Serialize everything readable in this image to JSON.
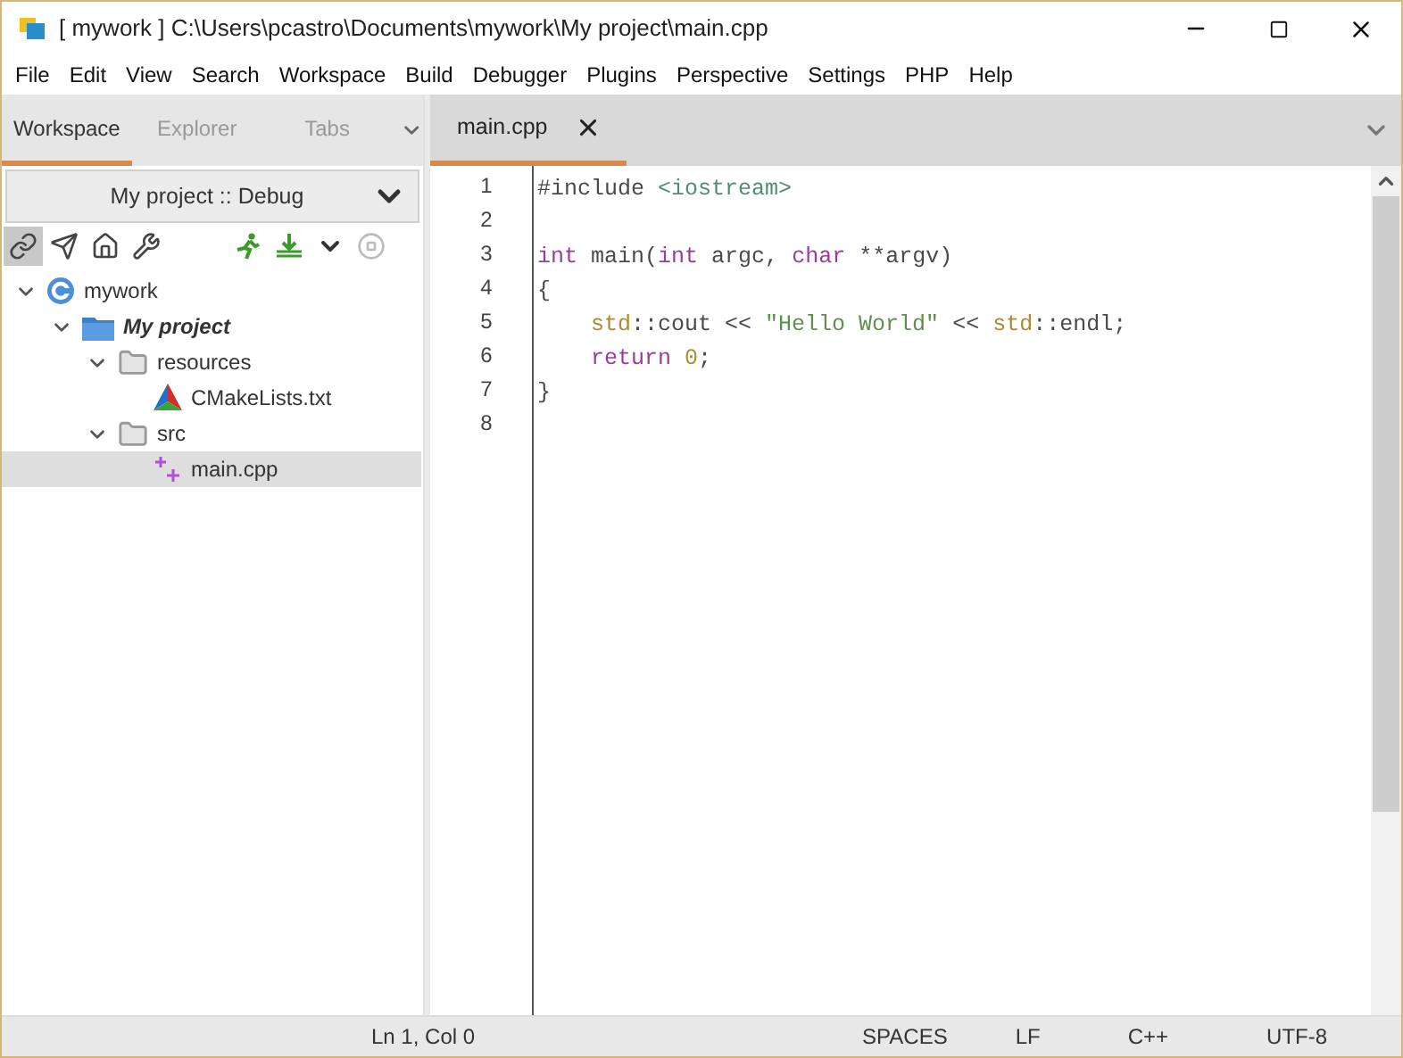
{
  "window": {
    "title": "[ mywork ] C:\\Users\\pcastro\\Documents\\mywork\\My project\\main.cpp"
  },
  "menu": [
    "File",
    "Edit",
    "View",
    "Search",
    "Workspace",
    "Build",
    "Debugger",
    "Plugins",
    "Perspective",
    "Settings",
    "PHP",
    "Help"
  ],
  "side_tabs": [
    {
      "label": "Workspace",
      "selected": true
    },
    {
      "label": "Explorer",
      "selected": false
    },
    {
      "label": "Tabs",
      "selected": false
    }
  ],
  "configuration": {
    "value": "My project :: Debug"
  },
  "toolbar": [
    {
      "kind": "link",
      "selected": true
    },
    {
      "kind": "send",
      "selected": false
    },
    {
      "kind": "home",
      "selected": false
    },
    {
      "kind": "wrench",
      "selected": false
    },
    {
      "kind": "run",
      "selected": false
    },
    {
      "kind": "build",
      "selected": false
    },
    {
      "kind": "caret",
      "selected": false
    },
    {
      "kind": "stop",
      "selected": false
    }
  ],
  "tree": [
    {
      "label": "mywork",
      "kind": "workspace",
      "expanded": true,
      "selected": false,
      "children": [
        {
          "label": "My project",
          "kind": "project",
          "expanded": true,
          "selected": false,
          "children": [
            {
              "label": "resources",
              "kind": "folder",
              "expanded": true,
              "selected": false,
              "children": [
                {
                  "label": "CMakeLists.txt",
                  "kind": "cmake",
                  "selected": false
                }
              ]
            },
            {
              "label": "src",
              "kind": "folder",
              "expanded": true,
              "selected": false,
              "children": [
                {
                  "label": "main.cpp",
                  "kind": "cpp",
                  "selected": true
                }
              ]
            }
          ]
        }
      ]
    }
  ],
  "editor_tabs": [
    {
      "label": "main.cpp",
      "selected": true
    }
  ],
  "code": [
    {
      "number": "1",
      "tokens": [
        {
          "text": "#include ",
          "kind": "plain"
        },
        {
          "text": "<iostream>",
          "kind": "include"
        }
      ]
    },
    {
      "number": "2"
    },
    {
      "number": "3",
      "tokens": [
        {
          "text": "int",
          "kind": "keyword"
        },
        {
          "text": " main(",
          "kind": "plain"
        },
        {
          "text": "int",
          "kind": "keyword"
        },
        {
          "text": " argc, ",
          "kind": "plain"
        },
        {
          "text": "char",
          "kind": "keyword"
        },
        {
          "text": " **argv)",
          "kind": "plain"
        }
      ]
    },
    {
      "number": "4",
      "tokens": [
        {
          "text": "{",
          "kind": "plain"
        }
      ]
    },
    {
      "number": "5",
      "indented": true,
      "tokens": [
        {
          "text": "std",
          "kind": "namespace"
        },
        {
          "text": "::cout << ",
          "kind": "plain"
        },
        {
          "text": "\"Hello World\"",
          "kind": "string"
        },
        {
          "text": " << ",
          "kind": "plain"
        },
        {
          "text": "std",
          "kind": "namespace"
        },
        {
          "text": "::endl;",
          "kind": "plain"
        }
      ]
    },
    {
      "number": "6",
      "indented": true,
      "tokens": [
        {
          "text": "return",
          "kind": "keyword"
        },
        {
          "text": " 0",
          "kind": "number"
        },
        {
          "text": ";",
          "kind": "plain"
        }
      ]
    },
    {
      "number": "7",
      "tokens": [
        {
          "text": "}",
          "kind": "plain"
        }
      ]
    },
    {
      "number": "8"
    }
  ],
  "status_bar": {
    "position": "Ln 1, Col 0",
    "indent": "SPACES",
    "eol": "LF",
    "language": "C++",
    "encoding": "UTF-8"
  }
}
